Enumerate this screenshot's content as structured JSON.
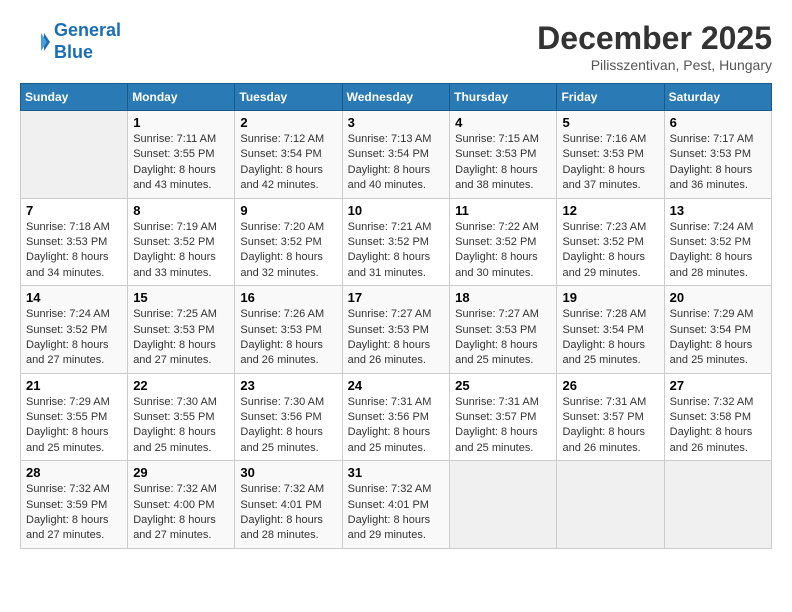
{
  "logo": {
    "line1": "General",
    "line2": "Blue"
  },
  "title": "December 2025",
  "subtitle": "Pilisszentivan, Pest, Hungary",
  "weekdays": [
    "Sunday",
    "Monday",
    "Tuesday",
    "Wednesday",
    "Thursday",
    "Friday",
    "Saturday"
  ],
  "weeks": [
    [
      {
        "day": "",
        "content": ""
      },
      {
        "day": "1",
        "content": "Sunrise: 7:11 AM\nSunset: 3:55 PM\nDaylight: 8 hours\nand 43 minutes."
      },
      {
        "day": "2",
        "content": "Sunrise: 7:12 AM\nSunset: 3:54 PM\nDaylight: 8 hours\nand 42 minutes."
      },
      {
        "day": "3",
        "content": "Sunrise: 7:13 AM\nSunset: 3:54 PM\nDaylight: 8 hours\nand 40 minutes."
      },
      {
        "day": "4",
        "content": "Sunrise: 7:15 AM\nSunset: 3:53 PM\nDaylight: 8 hours\nand 38 minutes."
      },
      {
        "day": "5",
        "content": "Sunrise: 7:16 AM\nSunset: 3:53 PM\nDaylight: 8 hours\nand 37 minutes."
      },
      {
        "day": "6",
        "content": "Sunrise: 7:17 AM\nSunset: 3:53 PM\nDaylight: 8 hours\nand 36 minutes."
      }
    ],
    [
      {
        "day": "7",
        "content": "Sunrise: 7:18 AM\nSunset: 3:53 PM\nDaylight: 8 hours\nand 34 minutes."
      },
      {
        "day": "8",
        "content": "Sunrise: 7:19 AM\nSunset: 3:52 PM\nDaylight: 8 hours\nand 33 minutes."
      },
      {
        "day": "9",
        "content": "Sunrise: 7:20 AM\nSunset: 3:52 PM\nDaylight: 8 hours\nand 32 minutes."
      },
      {
        "day": "10",
        "content": "Sunrise: 7:21 AM\nSunset: 3:52 PM\nDaylight: 8 hours\nand 31 minutes."
      },
      {
        "day": "11",
        "content": "Sunrise: 7:22 AM\nSunset: 3:52 PM\nDaylight: 8 hours\nand 30 minutes."
      },
      {
        "day": "12",
        "content": "Sunrise: 7:23 AM\nSunset: 3:52 PM\nDaylight: 8 hours\nand 29 minutes."
      },
      {
        "day": "13",
        "content": "Sunrise: 7:24 AM\nSunset: 3:52 PM\nDaylight: 8 hours\nand 28 minutes."
      }
    ],
    [
      {
        "day": "14",
        "content": "Sunrise: 7:24 AM\nSunset: 3:52 PM\nDaylight: 8 hours\nand 27 minutes."
      },
      {
        "day": "15",
        "content": "Sunrise: 7:25 AM\nSunset: 3:53 PM\nDaylight: 8 hours\nand 27 minutes."
      },
      {
        "day": "16",
        "content": "Sunrise: 7:26 AM\nSunset: 3:53 PM\nDaylight: 8 hours\nand 26 minutes."
      },
      {
        "day": "17",
        "content": "Sunrise: 7:27 AM\nSunset: 3:53 PM\nDaylight: 8 hours\nand 26 minutes."
      },
      {
        "day": "18",
        "content": "Sunrise: 7:27 AM\nSunset: 3:53 PM\nDaylight: 8 hours\nand 25 minutes."
      },
      {
        "day": "19",
        "content": "Sunrise: 7:28 AM\nSunset: 3:54 PM\nDaylight: 8 hours\nand 25 minutes."
      },
      {
        "day": "20",
        "content": "Sunrise: 7:29 AM\nSunset: 3:54 PM\nDaylight: 8 hours\nand 25 minutes."
      }
    ],
    [
      {
        "day": "21",
        "content": "Sunrise: 7:29 AM\nSunset: 3:55 PM\nDaylight: 8 hours\nand 25 minutes."
      },
      {
        "day": "22",
        "content": "Sunrise: 7:30 AM\nSunset: 3:55 PM\nDaylight: 8 hours\nand 25 minutes."
      },
      {
        "day": "23",
        "content": "Sunrise: 7:30 AM\nSunset: 3:56 PM\nDaylight: 8 hours\nand 25 minutes."
      },
      {
        "day": "24",
        "content": "Sunrise: 7:31 AM\nSunset: 3:56 PM\nDaylight: 8 hours\nand 25 minutes."
      },
      {
        "day": "25",
        "content": "Sunrise: 7:31 AM\nSunset: 3:57 PM\nDaylight: 8 hours\nand 25 minutes."
      },
      {
        "day": "26",
        "content": "Sunrise: 7:31 AM\nSunset: 3:57 PM\nDaylight: 8 hours\nand 26 minutes."
      },
      {
        "day": "27",
        "content": "Sunrise: 7:32 AM\nSunset: 3:58 PM\nDaylight: 8 hours\nand 26 minutes."
      }
    ],
    [
      {
        "day": "28",
        "content": "Sunrise: 7:32 AM\nSunset: 3:59 PM\nDaylight: 8 hours\nand 27 minutes."
      },
      {
        "day": "29",
        "content": "Sunrise: 7:32 AM\nSunset: 4:00 PM\nDaylight: 8 hours\nand 27 minutes."
      },
      {
        "day": "30",
        "content": "Sunrise: 7:32 AM\nSunset: 4:01 PM\nDaylight: 8 hours\nand 28 minutes."
      },
      {
        "day": "31",
        "content": "Sunrise: 7:32 AM\nSunset: 4:01 PM\nDaylight: 8 hours\nand 29 minutes."
      },
      {
        "day": "",
        "content": ""
      },
      {
        "day": "",
        "content": ""
      },
      {
        "day": "",
        "content": ""
      }
    ]
  ]
}
